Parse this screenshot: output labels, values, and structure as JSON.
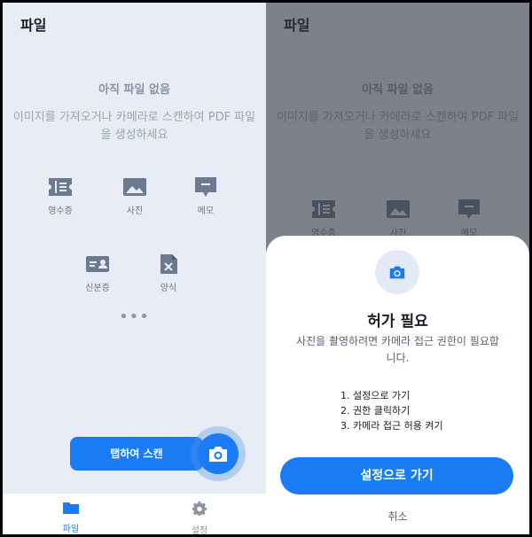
{
  "app": {
    "title": "파일"
  },
  "empty_state": {
    "title": "아직 파일 없음",
    "description": "이미지를 가져오거나 카메라로 스캔하여 PDF 파일을 생성하세요"
  },
  "categories": [
    {
      "label": "영수증",
      "icon": "receipt-icon"
    },
    {
      "label": "사진",
      "icon": "photo-icon"
    },
    {
      "label": "메모",
      "icon": "memo-icon"
    },
    {
      "label": "신분증",
      "icon": "id-card-icon"
    },
    {
      "label": "양식",
      "icon": "form-icon"
    }
  ],
  "more": {
    "label": "•••"
  },
  "scan": {
    "tooltip": "탭하여 스캔",
    "icon": "camera-icon"
  },
  "tabbar": [
    {
      "label": "파일",
      "icon": "folder-icon",
      "active": true
    },
    {
      "label": "설정",
      "icon": "gear-icon",
      "active": false
    }
  ],
  "permission_sheet": {
    "icon": "camera-icon",
    "title": "허가 필요",
    "description": "사진을 촬영하려면 카메라 접근 권한이 필요합니다.",
    "steps": [
      "1. 설정으로 가기",
      "2. 권한 클릭하기",
      "3. 카메라 접근 허용 켜기"
    ],
    "primary_button": "설정으로 가기",
    "cancel": "취소"
  },
  "colors": {
    "accent": "#1a7cf4",
    "background": "#e8edf5",
    "text_muted": "#8a93a3",
    "overlay": "rgba(48,52,60,0.58)"
  }
}
